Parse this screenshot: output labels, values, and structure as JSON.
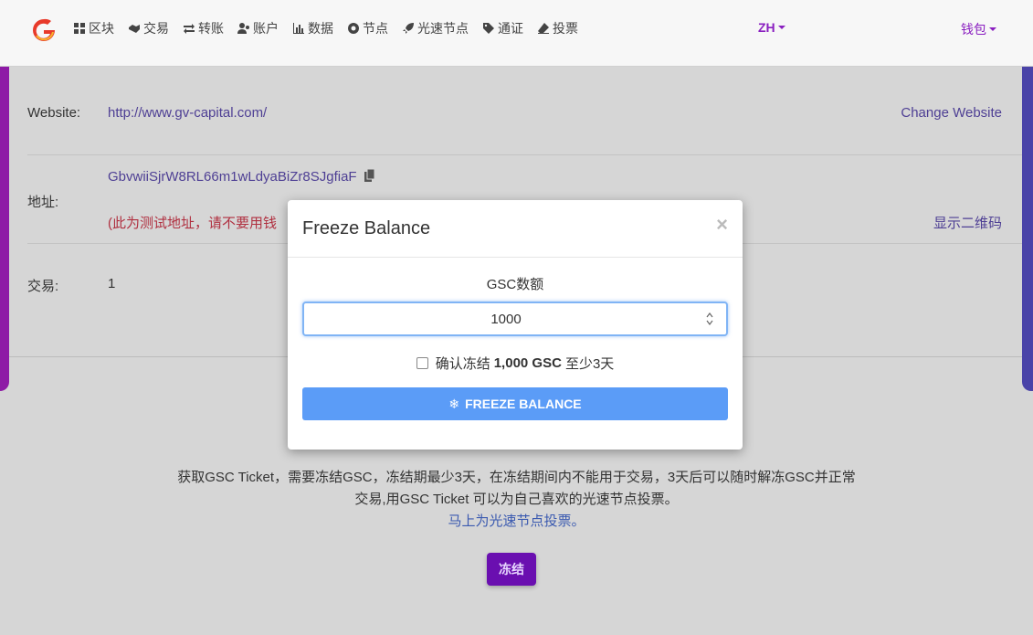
{
  "nav": {
    "items": [
      {
        "label": "区块",
        "icon": "grid-icon"
      },
      {
        "label": "交易",
        "icon": "handshake-icon"
      },
      {
        "label": "转账",
        "icon": "exchange-icon"
      },
      {
        "label": "账户",
        "icon": "users-icon"
      },
      {
        "label": "数据",
        "icon": "bar-chart-icon"
      },
      {
        "label": "节点",
        "icon": "circle-dot-icon"
      },
      {
        "label": "光速节点",
        "icon": "rocket-icon"
      },
      {
        "label": "通证",
        "icon": "tag-icon"
      },
      {
        "label": "投票",
        "icon": "eraser-icon"
      }
    ],
    "language": "ZH",
    "wallet": "钱包"
  },
  "account": {
    "website_label": "Website:",
    "website_value": "http://www.gv-capital.com/",
    "change_website": "Change Website",
    "address_label": "地址:",
    "address_value": "GbvwiiSjrW8RL66m1wLdyaBiZr8SJgfiaF",
    "address_warning": "(此为测试地址，请不要用钱",
    "show_qr": "显示二维码",
    "tx_label": "交易:",
    "tx_value": "1"
  },
  "info": {
    "line1": "获取GSC Ticket，需要冻结GSC，冻结期最少3天，在冻结期间内不能用于交易，3天后可以随时解冻GSC并正常",
    "line2": "交易,用GSC Ticket 可以为自己喜欢的光速节点投票。",
    "vote_link": "马上为光速节点投票。",
    "freeze_button": "冻结"
  },
  "modal": {
    "title": "Freeze Balance",
    "amount_label": "GSC数额",
    "amount_value": "1000",
    "confirm_prefix": "确认冻结",
    "confirm_amount": "1,000 GSC",
    "confirm_suffix": "至少3天",
    "button_label": "FREEZE BALANCE"
  },
  "colors": {
    "accent": "#8a1fc0",
    "button_blue": "#5b9cf7",
    "link": "#4e3f94"
  }
}
